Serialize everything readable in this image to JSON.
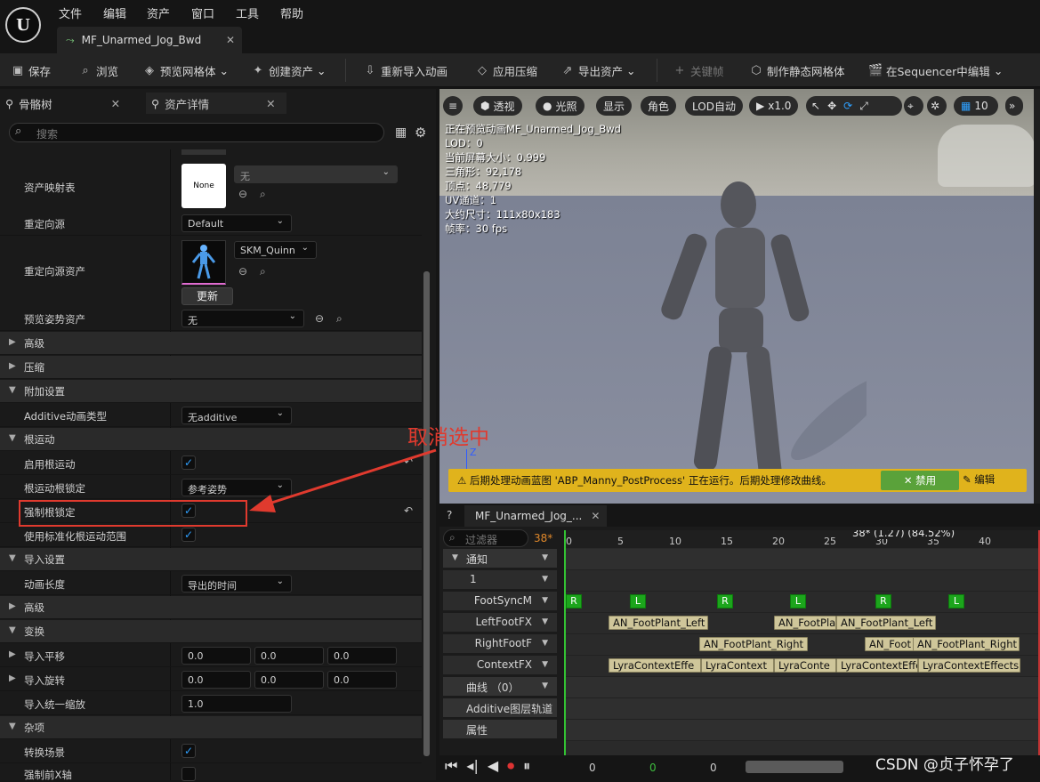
{
  "menu": [
    "文件",
    "编辑",
    "资产",
    "窗口",
    "工具",
    "帮助"
  ],
  "doc_tab": "MF_Unarmed_Jog_Bwd",
  "toolbar": {
    "save": "保存",
    "browse": "浏览",
    "preview_mesh": "预览网格体",
    "create_asset": "创建资产",
    "reimport": "重新导入动画",
    "apply_compression": "应用压缩",
    "export_asset": "导出资产",
    "keyframe": "关键帧",
    "make_static_mesh": "制作静态网格体",
    "edit_in_sequencer": "在Sequencer中编辑"
  },
  "panel_tabs": {
    "skeleton_tree": "骨骼树",
    "asset_details": "资产详情"
  },
  "search_placeholder": "搜索",
  "props": {
    "asset_mapping": "资产映射表",
    "none_thumb": "None",
    "none_value": "无",
    "retarget_source": "重定向源",
    "retarget_source_value": "Default",
    "retarget_source_asset": "重定向源资产",
    "retarget_asset_value": "SKM_Quinn",
    "update": "更新",
    "preview_pose_asset": "预览姿势资产",
    "preview_pose_value": "无",
    "advanced": "高级",
    "compression": "压缩",
    "additive_settings": "附加设置",
    "additive_anim_type": "Additive动画类型",
    "additive_value": "无additive",
    "root_motion": "根运动",
    "enable_root_motion": "启用根运动",
    "root_motion_root_lock": "根运动根锁定",
    "root_lock_value": "参考姿势",
    "force_root_lock": "强制根锁定",
    "use_normalized_root_motion": "使用标准化根运动范围",
    "import_settings": "导入设置",
    "anim_length": "动画长度",
    "anim_length_value": "导出的时间",
    "advanced2": "高级",
    "transform": "变换",
    "import_translation": "导入平移",
    "import_rotation": "导入旋转",
    "import_uniform_scale": "导入统一缩放",
    "t0": "0.0",
    "t1": "0.0",
    "t2": "0.0",
    "r0": "0.0",
    "r1": "0.0",
    "r2": "0.0",
    "scale": "1.0",
    "misc": "杂项",
    "convert_scene": "转换场景",
    "force_front_x": "强制前X轴"
  },
  "viewport": {
    "perspective": "透视",
    "lit": "光照",
    "show": "显示",
    "character": "角色",
    "lod_auto": "LOD自动",
    "speed": "x1.0",
    "grid_num": "10",
    "stats": [
      "正在预览动画MF_Unarmed_Jog_Bwd",
      "LOD：0",
      "当前屏幕大小：0.999",
      "三角形：92,178",
      "顶点：48,779",
      "UV通道：1",
      "大约尺寸：111x80x183",
      "帧率：30 fps"
    ],
    "axis_z": "Z",
    "warning": "后期处理动画蓝图 'ABP_Manny_PostProcess' 正在运行。后期处理修改曲线。",
    "disable": "禁用",
    "edit": "编辑"
  },
  "sequencer": {
    "tab": "MF_Unarmed_Jog_...",
    "filter_placeholder": "过滤器",
    "frame": "38*",
    "tracks": [
      "通知",
      "1",
      "FootSyncM",
      "LeftFootFX",
      "RightFootF",
      "ContextFX",
      "曲线 （0）",
      "Additive图层轨道",
      "属性"
    ],
    "ticks": [
      "0",
      "5",
      "10",
      "15",
      "20",
      "25",
      "30",
      "35",
      "40"
    ],
    "playhead": "38* (1.27) (84.52%)",
    "sync": [
      "R",
      "L",
      "R",
      "L",
      "R",
      "L"
    ],
    "left_notes": [
      "AN_FootPlant_Left",
      "AN_FootPla",
      "AN_FootPlant_Left"
    ],
    "right_notes": [
      "AN_FootPlant_Right",
      "AN_Foot",
      "AN_FootPlant_Right"
    ],
    "context_notes": [
      "LyraContextEffe",
      "LyraContext",
      "LyraConte",
      "LyraContextEffe",
      "LyraContextEffects"
    ],
    "bottom_nums": [
      "0",
      "0",
      "0"
    ]
  },
  "annotation": "取消选中",
  "watermark": "CSDN @贞子怀孕了"
}
